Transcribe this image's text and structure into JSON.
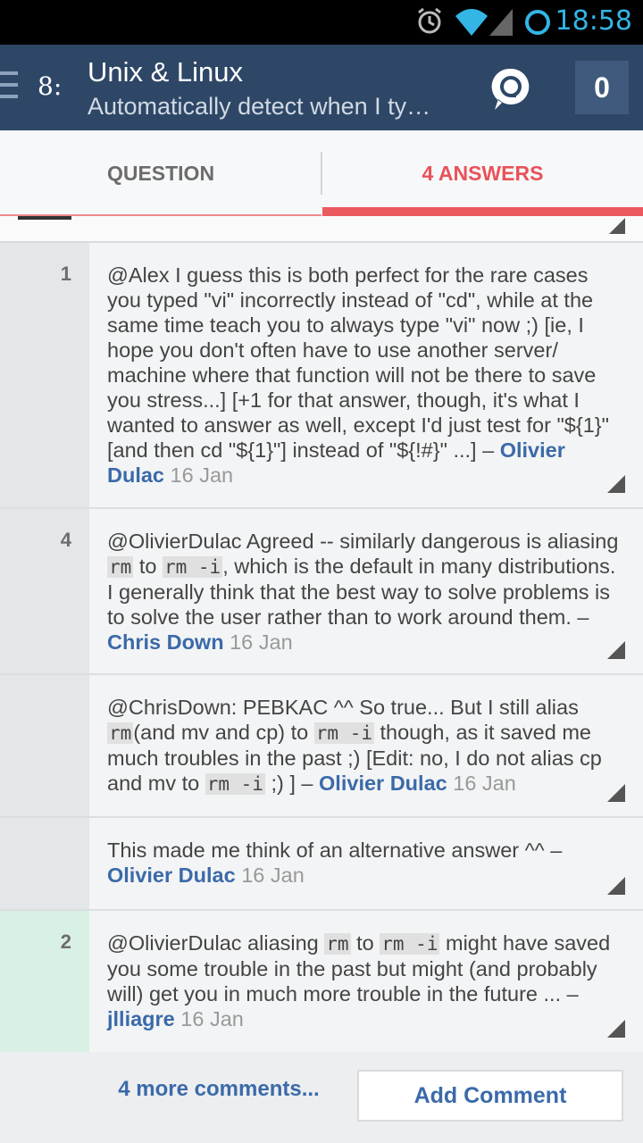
{
  "status_bar": {
    "time": "18:58"
  },
  "action_bar": {
    "title": "Unix & Linux",
    "subtitle": "Automatically detect when I ty…",
    "count": "0",
    "logo_glyph": "8:"
  },
  "tabs": [
    {
      "label": "QUESTION",
      "active": false
    },
    {
      "label": "4 ANSWERS",
      "active": true
    }
  ],
  "comments": [
    {
      "score": "1",
      "text": "@Alex I guess this is both perfect for the rare cases you typed \"vi\" incorrectly instead of \"cd\", while at the same time teach you to always type \"vi\" now ;) [ie, I hope you don't often have to use another server/ machine where that function will not be there to save you stress...] [+1 for that answer, though, it's what I wanted to answer as well, except I'd just test for \"${1}\" [and then cd \"${1}\"] instead of \"${!#}\" ...] – ",
      "author": "Olivier Dulac",
      "date": "16 Jan"
    },
    {
      "score": "4",
      "parts": [
        "@OlivierDulac Agreed -- similarly dangerous is aliasing ",
        "rm",
        " to ",
        "rm -i",
        ", which is the default in many distributions. I generally think that the best way to solve problems is to solve the user rather than to work around them. – "
      ],
      "author": "Chris Down",
      "date": "16 Jan"
    },
    {
      "score": "",
      "parts": [
        "@ChrisDown: PEBKAC ^^ So true... But I still alias ",
        "rm",
        "(and mv and cp) to ",
        "rm -i",
        " though, as it saved me much troubles in the past ;) [Edit: no, I do not alias cp and mv to ",
        "rm -i",
        " ;) ] – "
      ],
      "author": "Olivier Dulac",
      "date": "16 Jan"
    },
    {
      "score": "",
      "text": "This made me think of an alternative answer ^^ – ",
      "author": "Olivier Dulac",
      "date": "16 Jan"
    },
    {
      "score": "2",
      "parts": [
        "@OlivierDulac aliasing ",
        "rm",
        " to ",
        "rm -i",
        " might have saved you some trouble in the past but might (and probably will) get you in much more trouble in the future ... – "
      ],
      "author": "jlliagre",
      "date": "16 Jan"
    }
  ],
  "footer": {
    "more_comments": "4 more comments...",
    "add_comment": "Add Comment"
  },
  "colors": {
    "action_bar": "#2e4766",
    "accent": "#ea5a5f",
    "link": "#3b6aa9"
  }
}
